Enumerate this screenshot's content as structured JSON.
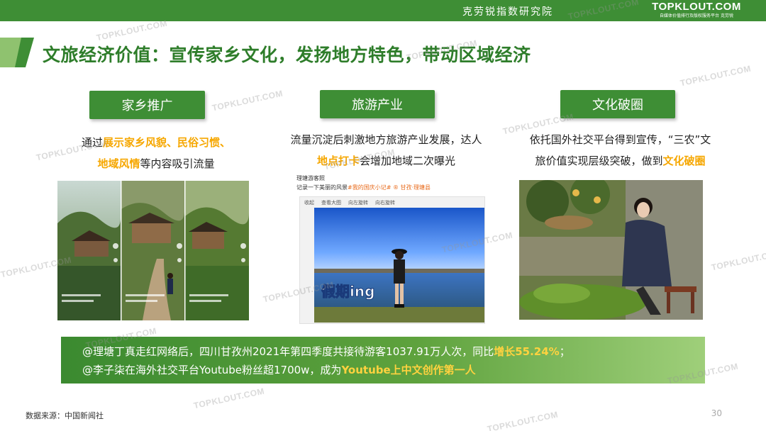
{
  "header": {
    "org_name": "克劳锐指数研究院",
    "brand_logo": "TOPKLOUT.COM",
    "brand_tagline": "自媒体价值排行及版权服务平台 克劳锐"
  },
  "title": "文旅经济价值：宣传家乡文化，发扬地方特色，带动区域经济",
  "columns": [
    {
      "label": "家乡推广",
      "desc_line1_pre": "通过",
      "desc_line1_hl": "展示家乡风貌、民俗习惯、",
      "desc_line2_hl": "地域风情",
      "desc_line2_post": "等内容吸引流量"
    },
    {
      "label": "旅游产业",
      "desc_line1": "流量沉淀后刺激地方旅游产业发展，达人",
      "desc_line2_hl": "地点打卡",
      "desc_line2_post": "会增加地域二次曝光"
    },
    {
      "label": "文化破圈",
      "desc_line1": "依托国外社交平台得到宣传，“三农”文",
      "desc_line2_pre": "旅价值实现层级突破，做到",
      "desc_line2_hl": "文化破圈"
    }
  ],
  "post_card": {
    "author": "理塘游客照",
    "caption_pre": "记录一下美丽的风景",
    "caption_tags": "#我的国庆小记# ® 甘孜·理塘县",
    "toolbar": [
      "收起",
      "查看大图",
      "向左旋转",
      "向右旋转"
    ],
    "image_text": "假期ing"
  },
  "stats": {
    "line1_pre": "@理塘丁真走红网络后，四川甘孜州2021年第四季度共接待游客1037.91万人次，同比",
    "line1_hl": "增长55.24%",
    "line1_post": "；",
    "line2_pre": "@李子柒在海外社交平台Youtube粉丝超1700w，成为",
    "line2_hl": "Youtube上中文创作第一人"
  },
  "source": "数据来源：中国新闻社",
  "page_number": "30",
  "watermark_text": "TOPKLOUT.COM",
  "colors": {
    "brand_green": "#3e8e35",
    "title_green": "#2e7d2a",
    "highlight_orange": "#f6a700",
    "highlight_yellow": "#ffd23f"
  }
}
